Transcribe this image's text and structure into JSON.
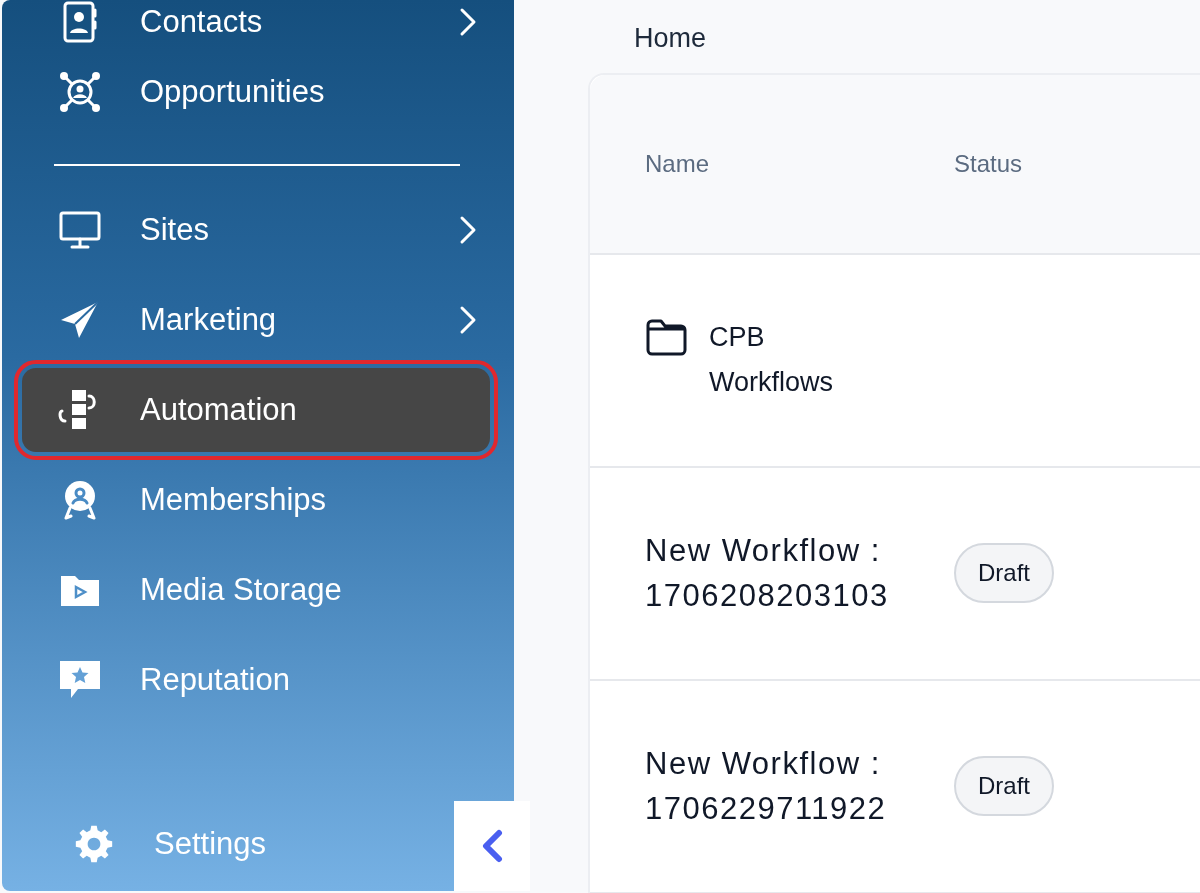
{
  "sidebar": {
    "items": [
      {
        "kind": "link",
        "label": "Contacts",
        "has_submenu": true,
        "selected": false,
        "highlighted": false
      },
      {
        "kind": "link",
        "label": "Opportunities",
        "has_submenu": false,
        "selected": false,
        "highlighted": false
      },
      {
        "kind": "divider"
      },
      {
        "kind": "link",
        "label": "Sites",
        "has_submenu": true,
        "selected": false,
        "highlighted": false
      },
      {
        "kind": "link",
        "label": "Marketing",
        "has_submenu": true,
        "selected": false,
        "highlighted": false
      },
      {
        "kind": "link",
        "label": "Automation",
        "has_submenu": false,
        "selected": true,
        "highlighted": true
      },
      {
        "kind": "link",
        "label": "Memberships",
        "has_submenu": false,
        "selected": false,
        "highlighted": false
      },
      {
        "kind": "link",
        "label": "Media Storage",
        "has_submenu": false,
        "selected": false,
        "highlighted": false
      },
      {
        "kind": "link",
        "label": "Reputation",
        "has_submenu": false,
        "selected": false,
        "highlighted": false
      }
    ],
    "footer_item": {
      "label": "Settings"
    }
  },
  "breadcrumb": "Home",
  "table": {
    "columns": [
      "Name",
      "Status"
    ],
    "rows": [
      {
        "kind": "folder",
        "name": "CPB Workflows"
      },
      {
        "kind": "workflow",
        "name": "New Workflow : 1706208203103",
        "status": "Draft"
      },
      {
        "kind": "workflow",
        "name": "New Workflow : 1706229711922",
        "status": "Draft"
      }
    ]
  }
}
